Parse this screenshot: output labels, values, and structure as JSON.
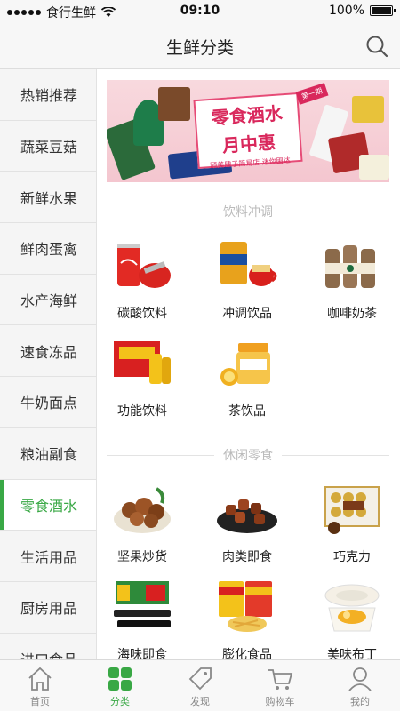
{
  "status_bar": {
    "carrier": "食行生鲜",
    "time": "09:10",
    "battery": "100%"
  },
  "nav": {
    "title": "生鲜分类"
  },
  "sidebar": {
    "items": [
      {
        "label": "热销推荐"
      },
      {
        "label": "蔬菜豆菇"
      },
      {
        "label": "新鲜水果"
      },
      {
        "label": "鲜肉蛋禽"
      },
      {
        "label": "水产海鲜"
      },
      {
        "label": "速食冻品"
      },
      {
        "label": "牛奶面点"
      },
      {
        "label": "粮油副食"
      },
      {
        "label": "零食酒水"
      },
      {
        "label": "生活用品"
      },
      {
        "label": "厨房用品"
      },
      {
        "label": "进口食品"
      }
    ],
    "active_index": 8
  },
  "banner": {
    "title_line1": "零食酒水",
    "title_line2": "月中惠",
    "subtitle": "颐美肆子简易店 迷你囤达",
    "tag": "第一期"
  },
  "sections": [
    {
      "title": "饮料冲调",
      "items": [
        {
          "label": "碳酸饮料",
          "icon": "cola-can-icon"
        },
        {
          "label": "冲调饮品",
          "icon": "milk-tea-powder-icon"
        },
        {
          "label": "咖啡奶茶",
          "icon": "coffee-bottles-icon"
        },
        {
          "label": "功能饮料",
          "icon": "energy-drink-box-icon"
        },
        {
          "label": "茶饮品",
          "icon": "citron-tea-jar-icon"
        }
      ]
    },
    {
      "title": "休闲零食",
      "items": [
        {
          "label": "坚果炒货",
          "icon": "nuts-bowl-icon"
        },
        {
          "label": "肉类即食",
          "icon": "jerky-plate-icon"
        },
        {
          "label": "巧克力",
          "icon": "chocolate-box-icon"
        },
        {
          "label": "海味即食",
          "icon": "seaweed-snack-icon"
        },
        {
          "label": "膨化食品",
          "icon": "chips-bag-icon"
        },
        {
          "label": "美味布丁",
          "icon": "pudding-cup-icon"
        }
      ]
    }
  ],
  "tab_bar": {
    "tabs": [
      {
        "label": "首页",
        "icon": "home-icon"
      },
      {
        "label": "分类",
        "icon": "category-grid-icon"
      },
      {
        "label": "发现",
        "icon": "tag-icon"
      },
      {
        "label": "购物车",
        "icon": "cart-icon"
      },
      {
        "label": "我的",
        "icon": "user-icon"
      }
    ],
    "active_index": 1
  },
  "colors": {
    "accent": "#39a845",
    "banner_pink": "#d9285c"
  }
}
